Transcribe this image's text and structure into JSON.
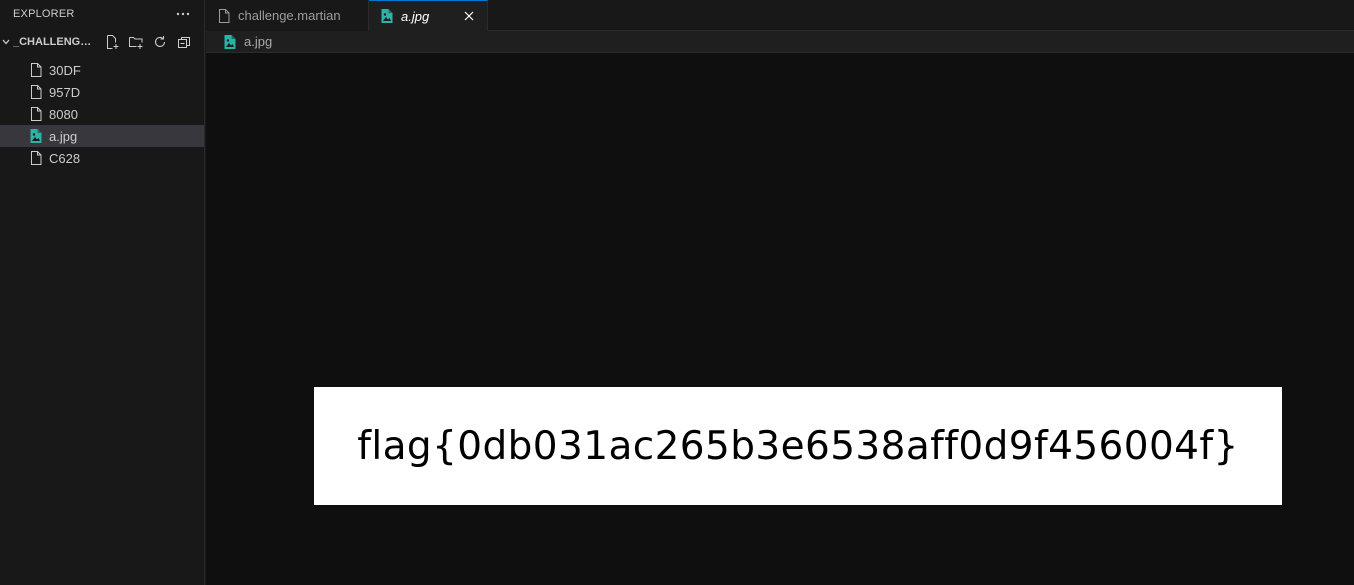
{
  "explorer": {
    "title": "EXPLORER",
    "section_label": "_CHALLENGE....",
    "files": [
      {
        "name": "30DF",
        "icon": "file-icon"
      },
      {
        "name": "957D",
        "icon": "file-icon"
      },
      {
        "name": "8080",
        "icon": "file-icon"
      },
      {
        "name": "a.jpg",
        "icon": "image-file-icon",
        "selected": true
      },
      {
        "name": "C628",
        "icon": "file-icon"
      }
    ]
  },
  "tabs": [
    {
      "label": "challenge.martian",
      "icon": "file-icon",
      "active": false
    },
    {
      "label": "a.jpg",
      "icon": "image-file-icon",
      "active": true
    }
  ],
  "breadcrumb": {
    "label": "a.jpg",
    "icon": "image-file-icon"
  },
  "preview": {
    "text": "flag{0db031ac265b3e6538aff0d9f456004f}"
  },
  "colors": {
    "accent": "#0078d4",
    "image_icon": "#2bb3a6",
    "sidebar_bg": "#181818",
    "editor_bg": "#0f0f0f",
    "selected_bg": "#37373d"
  }
}
